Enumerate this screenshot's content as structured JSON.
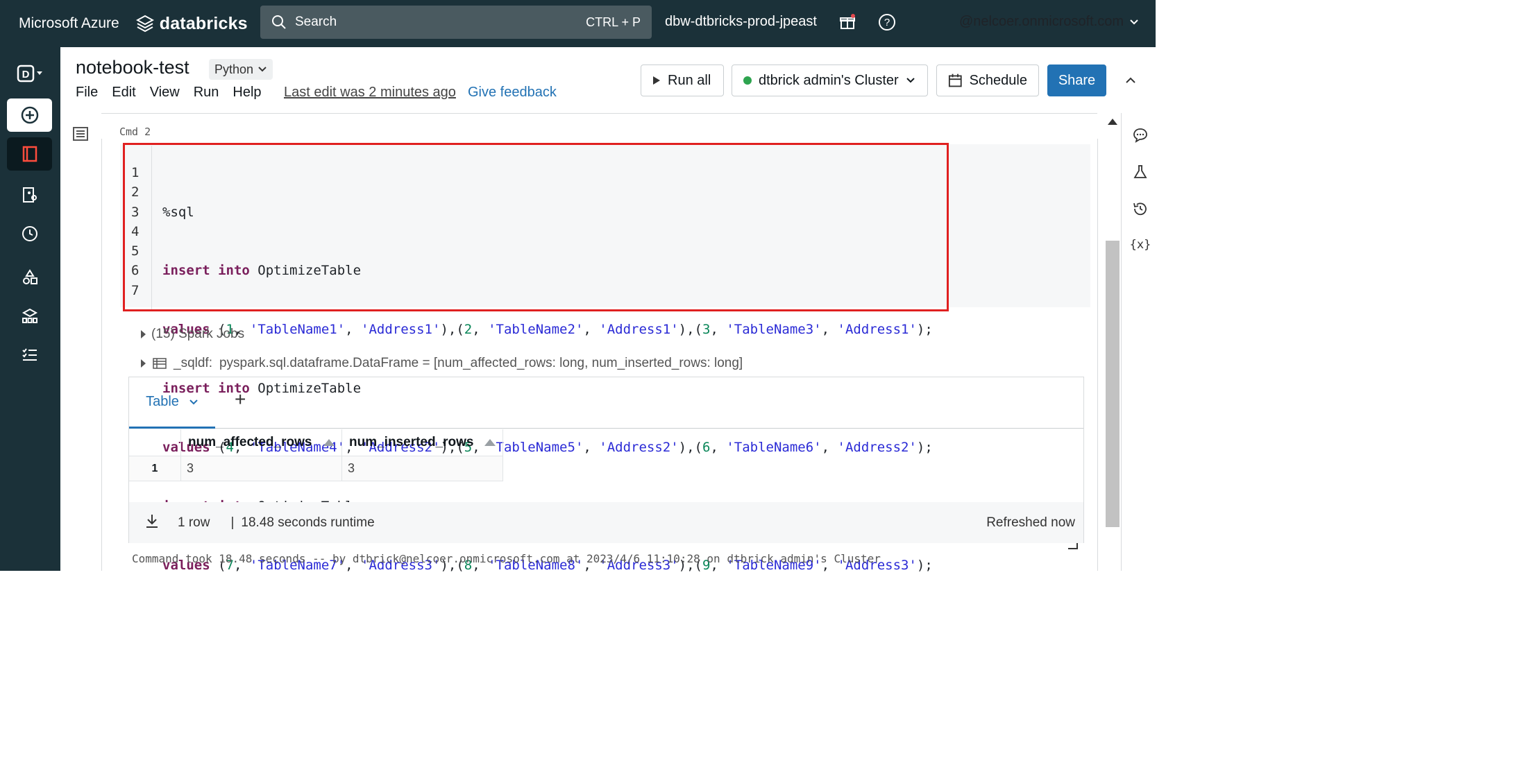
{
  "topbar": {
    "brand": "Microsoft Azure",
    "product": "databricks",
    "search_placeholder": "Search",
    "search_shortcut": "CTRL + P",
    "workspace": "dbw-dtbricks-prod-jpeast",
    "user": "@nelcoer.onmicrosoft.com"
  },
  "notebook": {
    "title": "notebook-test",
    "language": "Python",
    "menu": [
      "File",
      "Edit",
      "View",
      "Run",
      "Help"
    ],
    "last_edit": "Last edit was 2 minutes ago",
    "feedback": "Give feedback",
    "run_all": "Run all",
    "cluster": "dtbrick admin's Cluster",
    "schedule": "Schedule",
    "share": "Share"
  },
  "cell": {
    "cmd_label": "Cmd 2",
    "line_numbers": [
      "1",
      "2",
      "3",
      "4",
      "5",
      "6",
      "7"
    ],
    "code": [
      "%sql",
      "insert into OptimizeTable",
      "values (1, 'TableName1', 'Address1'),(2, 'TableName2', 'Address1'),(3, 'TableName3', 'Address1');",
      "insert into OptimizeTable",
      "values (4, 'TableName4', 'Address2'),(5, 'TableName5', 'Address2'),(6, 'TableName6', 'Address2');",
      "insert into OptimizeTable",
      "values (7, 'TableName7', 'Address3'),(8, 'TableName8', 'Address3'),(9, 'TableName9', 'Address3');"
    ],
    "spark_jobs": "(15) Spark Jobs",
    "sqldf_name": "_sqldf:",
    "sqldf_type": "pyspark.sql.dataframe.DataFrame = [num_affected_rows: long, num_inserted_rows: long]",
    "result": {
      "tab_label": "Table",
      "add_tab": "+",
      "columns": [
        "num_affected_rows",
        "num_inserted_rows"
      ],
      "rows": [
        {
          "index": "1",
          "values": [
            "3",
            "3"
          ]
        }
      ],
      "row_count": "1 row",
      "separator": "|",
      "runtime": "18.48 seconds runtime",
      "refreshed": "Refreshed now"
    },
    "command_took": "Command took 18.48 seconds -- by dtbrick@nelcoer.onmicrosoft.com at 2023/4/6 11:10:28 on dtbrick admin's Cluster"
  },
  "rail": {
    "variables_label": "{x}"
  },
  "colors": {
    "topbar_bg": "#1b3139",
    "accent": "#2272b4",
    "highlight_border": "#e02020",
    "keyword": "#7a1f5c",
    "string": "#2b2bd6",
    "number": "#098658",
    "cluster_status": "#2ea44f"
  }
}
